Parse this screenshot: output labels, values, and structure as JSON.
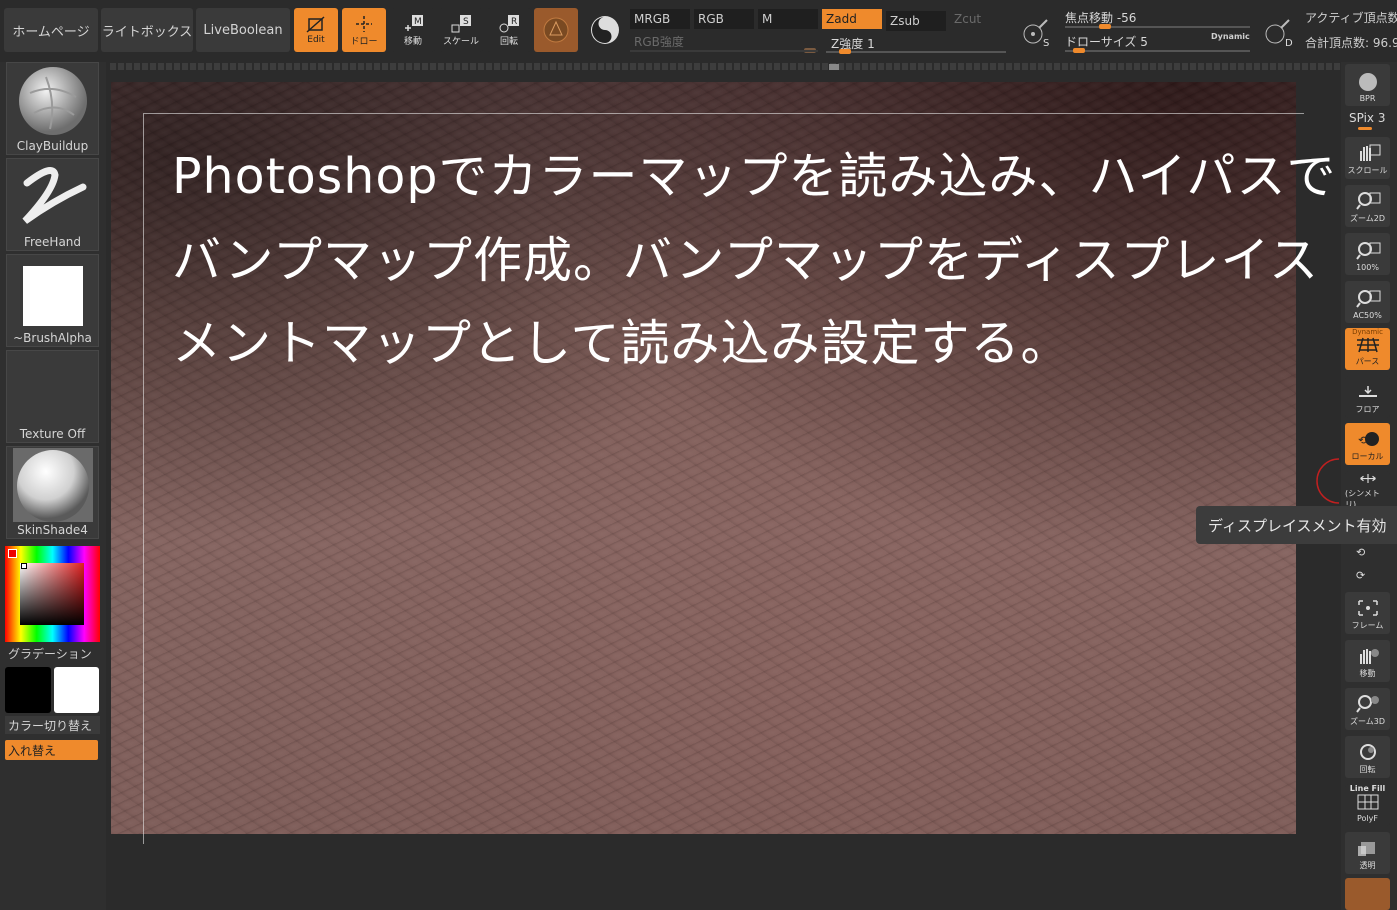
{
  "nav": {
    "home": "ホームページ",
    "lightbox": "ライトボックス",
    "liveboolean": "LiveBoolean"
  },
  "tools": {
    "edit": "Edit",
    "draw": "ドロー",
    "move": "移動",
    "scale": "スケール",
    "rotate": "回転"
  },
  "channels": {
    "mrgb": "MRGB",
    "rgb": "RGB",
    "m": "M",
    "zadd": "Zadd",
    "zsub": "Zsub",
    "zcut": "Zcut",
    "rgb_intensity": "RGB強度",
    "z_intensity": "Z強度",
    "z_intensity_value": "1"
  },
  "sliders": {
    "focal_shift_label": "焦点移動",
    "focal_shift_value": "-56",
    "draw_size_label": "ドローサイズ",
    "draw_size_value": "5",
    "dynamic": "Dynamic"
  },
  "stats": {
    "active_points": "アクティブ頂点数",
    "total_points": "合計頂点数: 96.9"
  },
  "left_panel": {
    "brush": "ClayBuildup",
    "stroke": "FreeHand",
    "alpha": "~BrushAlpha",
    "texture": "Texture Off",
    "material": "SkinShade4",
    "gradient": "グラデーション",
    "color_switch": "カラー切り替え",
    "swap": "入れ替え"
  },
  "overlay": {
    "line1": "Photoshopでカラーマップを読み込み、ハイパスで",
    "line2": "バンプマップ作成。バンプマップをディスプレイス",
    "line3": "メントマップとして読み込み設定する。"
  },
  "right_panel": {
    "bpr": "BPR",
    "spix": "SPix 3",
    "scroll": "スクロール",
    "zoom2d": "ズーム2D",
    "actual": "100%",
    "ac50": "AC50%",
    "persp": "パース",
    "dynamic": "Dynamic",
    "floor": "フロア",
    "local": "ローカル",
    "sym": "(シンメトリ)",
    "frame": "フレーム",
    "move": "移動",
    "zoom3d": "ズーム3D",
    "rotate": "回転",
    "linefill": "Line Fill",
    "polyf": "PolyF",
    "transp": "透明"
  },
  "tooltip": "ディスプレイスメント有効",
  "colors": {
    "accent": "#ef8a2c",
    "panel": "#2b2b2b",
    "button": "#3a3a3a"
  }
}
